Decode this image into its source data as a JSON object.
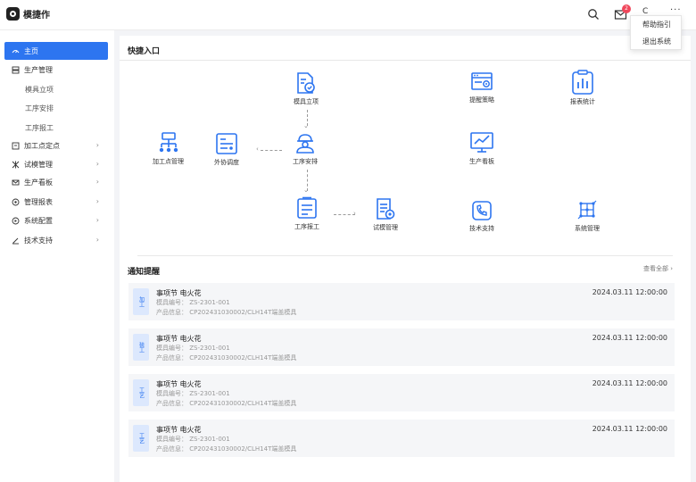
{
  "app": {
    "name": "模捷作"
  },
  "topbar": {
    "badge_count": "2",
    "user_initial": "C",
    "more": "···",
    "dropdown": [
      "帮助指引",
      "退出系统"
    ]
  },
  "sidebar": {
    "items": [
      {
        "label": "主页",
        "icon": "home-icon",
        "active": true
      },
      {
        "label": "生产管理",
        "icon": "production-icon"
      },
      {
        "label": "模具立项",
        "sub": true
      },
      {
        "label": "工序安排",
        "sub": true
      },
      {
        "label": "工序报工",
        "sub": true
      },
      {
        "label": "加工点定点",
        "icon": "processing-point-icon",
        "chevron": "›"
      },
      {
        "label": "试模管理",
        "icon": "trial-mold-icon",
        "chevron": "›"
      },
      {
        "label": "生产看板",
        "icon": "dashboard-icon",
        "chevron": "›"
      },
      {
        "label": "管理报表",
        "icon": "report-icon",
        "chevron": "›"
      },
      {
        "label": "系统配置",
        "icon": "settings-icon",
        "chevron": "›"
      },
      {
        "label": "技术支持",
        "icon": "support-icon",
        "chevron": "›"
      }
    ]
  },
  "quick": {
    "title": "快捷入口",
    "items": {
      "mold_project": "模具立项",
      "reminder_policy": "提醒策略",
      "report_stats": "报表统计",
      "processing_mgmt": "加工点管理",
      "outsource": "外协调度",
      "process_arrange": "工序安排",
      "production_board": "生产看板",
      "process_report": "工序报工",
      "trial_mgmt": "试模管理",
      "tech_support": "技术支持",
      "system_mgmt": "系统管理"
    }
  },
  "notices": {
    "title": "通知提醒",
    "view_all": "查看全部 ›",
    "items": [
      {
        "tag": "加工",
        "title": "事项节 电火花",
        "mold": "模具编号：  ZS-2301-001",
        "product": "产品信息：  CP202431030002/CLH14T端盖模具",
        "time": "2024.03.11 12:00:00"
      },
      {
        "tag": "装工",
        "title": "事项节 电火花",
        "mold": "模具编号：  ZS-2301-001",
        "product": "产品信息：  CP202431030002/CLH14T端盖模具",
        "time": "2024.03.11 12:00:00"
      },
      {
        "tag": "工艺",
        "title": "事项节 电火花",
        "mold": "模具编号：  ZS-2301-001",
        "product": "产品信息：  CP202431030002/CLH14T端盖模具",
        "time": "2024.03.11 12:00:00"
      },
      {
        "tag": "工艺",
        "title": "事项节 电火花",
        "mold": "模具编号：  ZS-2301-001",
        "product": "产品信息：  CP202431030002/CLH14T端盖模具",
        "time": "2024.03.11 12:00:00"
      }
    ]
  },
  "colors": {
    "accent": "#2d75f0",
    "badge": "#f0475b"
  }
}
